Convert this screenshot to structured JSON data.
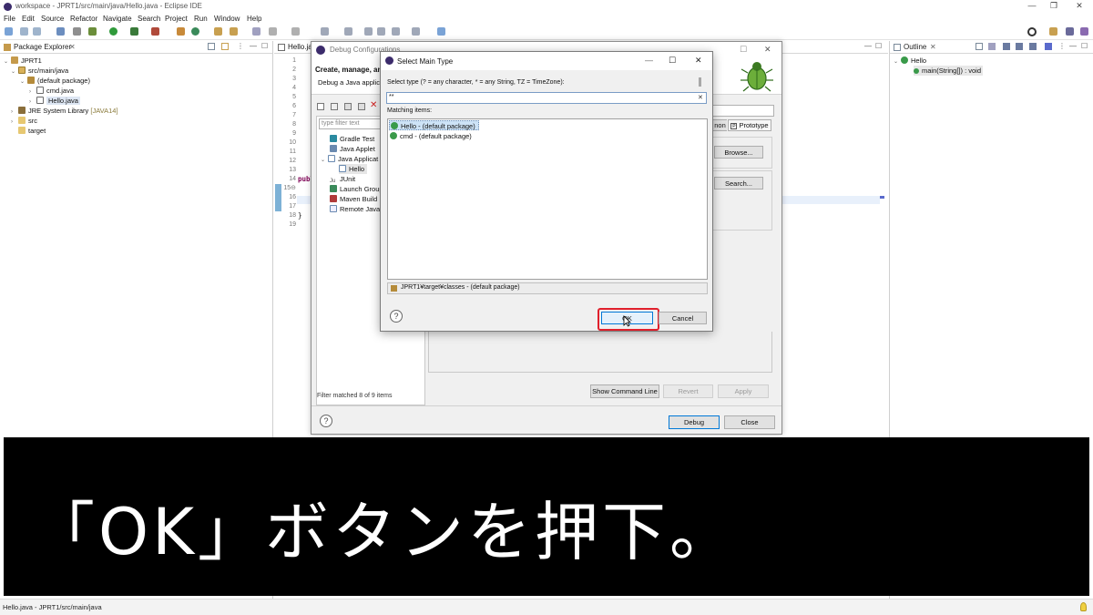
{
  "window": {
    "title": "workspace - JPRT1/src/main/java/Hello.java - Eclipse IDE",
    "minimize": "—",
    "maximize": "❐",
    "close": "✕"
  },
  "menu": [
    "File",
    "Edit",
    "Source",
    "Refactor",
    "Navigate",
    "Search",
    "Project",
    "Run",
    "Window",
    "Help"
  ],
  "package_explorer": {
    "tab_label": "Package Explorer",
    "tree": [
      {
        "label": "JPRT1",
        "depth": 0,
        "expanded": true,
        "icon": "project-icon"
      },
      {
        "label": "src/main/java",
        "depth": 1,
        "expanded": true,
        "icon": "source-folder-icon"
      },
      {
        "label": "(default package)",
        "depth": 2,
        "expanded": true,
        "icon": "package-icon"
      },
      {
        "label": "cmd.java",
        "depth": 3,
        "expanded": false,
        "icon": "java-file-icon"
      },
      {
        "label": "Hello.java",
        "depth": 3,
        "expanded": false,
        "icon": "java-file-icon",
        "selected": true
      },
      {
        "label": "JRE System Library",
        "suffix": "[JAVA14]",
        "depth": 1,
        "expanded": false,
        "icon": "library-icon"
      },
      {
        "label": "src",
        "depth": 1,
        "expanded": false,
        "icon": "folder-icon"
      },
      {
        "label": "target",
        "depth": 1,
        "expanded": false,
        "icon": "folder-icon"
      }
    ]
  },
  "editor": {
    "tab_label": "Hello.ja",
    "line_numbers": [
      "1",
      "2",
      "3",
      "4",
      "5",
      "6",
      "7",
      "8",
      "9",
      "10",
      "11",
      "12",
      "13",
      "14",
      "15⊖",
      "16",
      "17",
      "18",
      "19"
    ],
    "code_line_14": "publ",
    "code_line_18": "}"
  },
  "outline": {
    "tab_label": "Outline",
    "class_name": "Hello",
    "method": "main(String[]) : void"
  },
  "debug_configurations": {
    "title": "Debug Configurations",
    "header_title": "Create, manage, an",
    "header_desc": "Debug a Java applica",
    "filter_placeholder": "type filter text",
    "config_types": [
      "Gradle Test",
      "Java Applet",
      "Java Applicat",
      "Hello",
      "JUnit",
      "Launch Group",
      "Maven Build",
      "Remote Java"
    ],
    "filter_status": "Filter matched 8 of 9 items",
    "tab_partial": "non",
    "tab_prototype": "Prototype",
    "browse_button": "Browse...",
    "search_button": "Search...",
    "show_command_line": "Show Command Line",
    "revert": "Revert",
    "apply": "Apply",
    "debug": "Debug",
    "close": "Close",
    "help": "?"
  },
  "select_main_type": {
    "title": "Select Main Type",
    "prompt": "Select type (? = any character, * = any String, TZ = TimeZone):",
    "search_value": "**",
    "clear": "✕",
    "matching_label": "Matching items:",
    "items": [
      {
        "label": "Hello - (default package)",
        "selected": true
      },
      {
        "label": "cmd - (default package)",
        "selected": false
      }
    ],
    "location": "JPRT1¥target¥classes - (default package)",
    "ok": "OK",
    "cancel": "Cancel",
    "help": "?",
    "minimize": "—",
    "maximize": "☐",
    "close": "✕"
  },
  "subtitle": "「OK」ボタンを押下。",
  "status_bar": "Hello.java - JPRT1/src/main/java",
  "colors": {
    "highlight_red": "#e0202c",
    "selection_blue": "#cde3f7",
    "subtitle_bg": "#000000"
  }
}
